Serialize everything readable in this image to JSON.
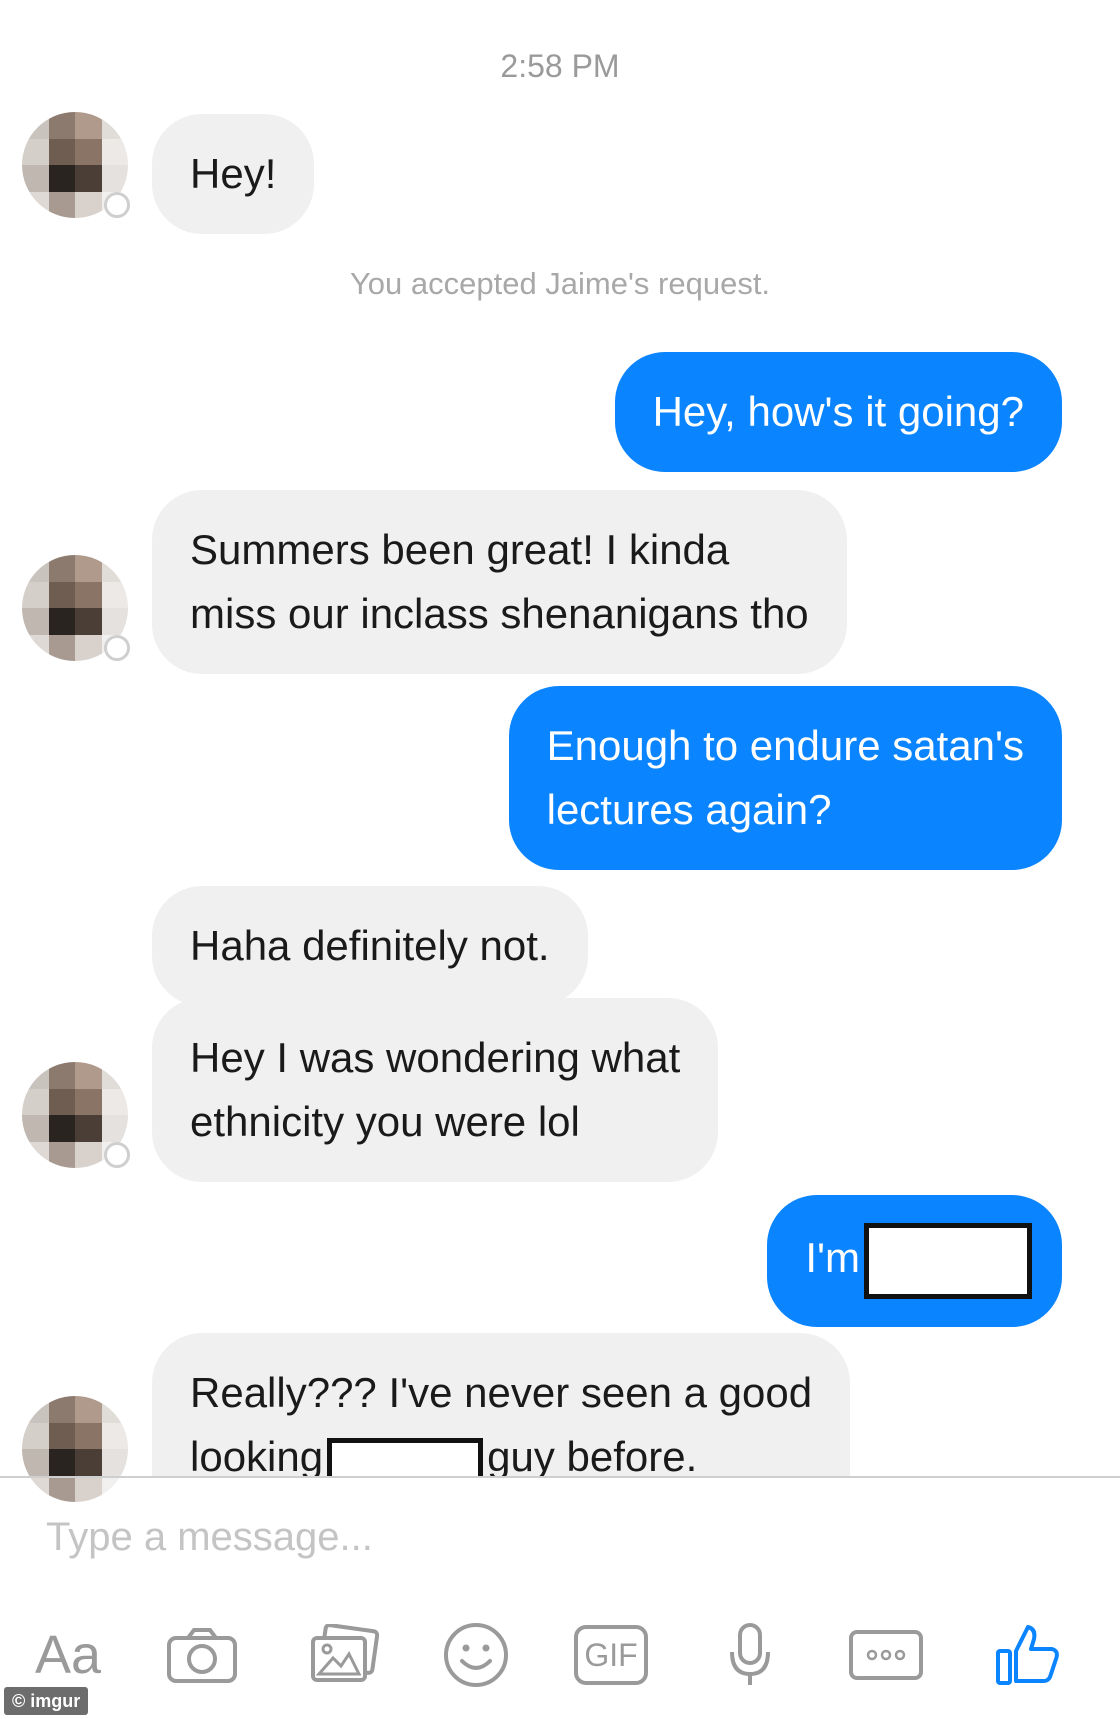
{
  "conversation": {
    "timestamp": "2:58 PM",
    "system_note": "You accepted Jaime's request."
  },
  "messages": [
    {
      "direction": "incoming",
      "lines": [
        "Hey!"
      ]
    },
    {
      "direction": "outgoing",
      "lines": [
        "Hey, how's it going?"
      ]
    },
    {
      "direction": "incoming",
      "lines": [
        "Summers been great! I kinda",
        "miss our inclass shenanigans tho"
      ]
    },
    {
      "direction": "outgoing",
      "lines": [
        "Enough to endure satan's",
        "lectures again?"
      ]
    },
    {
      "direction": "incoming",
      "lines": [
        "Haha definitely not."
      ]
    },
    {
      "direction": "incoming",
      "lines": [
        "Hey I was wondering what",
        "ethnicity you were lol"
      ]
    },
    {
      "direction": "outgoing",
      "lines": [
        "I'm"
      ]
    },
    {
      "direction": "incoming",
      "lines": [
        "Really??? I've never seen a good",
        "looking",
        "guy before."
      ]
    }
  ],
  "composer": {
    "placeholder": "Type a message..."
  },
  "toolbar": {
    "aa_label": "Aa",
    "gif_label": "GIF",
    "icons": [
      "text-format-icon",
      "camera-icon",
      "gallery-icon",
      "emoji-icon",
      "gif-icon",
      "microphone-icon",
      "more-icon",
      "like-icon"
    ]
  },
  "colors": {
    "outgoing_bubble": "#0a84ff",
    "incoming_bubble": "#f0f0f0",
    "icon_gray": "#9a9a9a",
    "like_blue": "#0a84ff"
  },
  "watermark": "© imgur"
}
